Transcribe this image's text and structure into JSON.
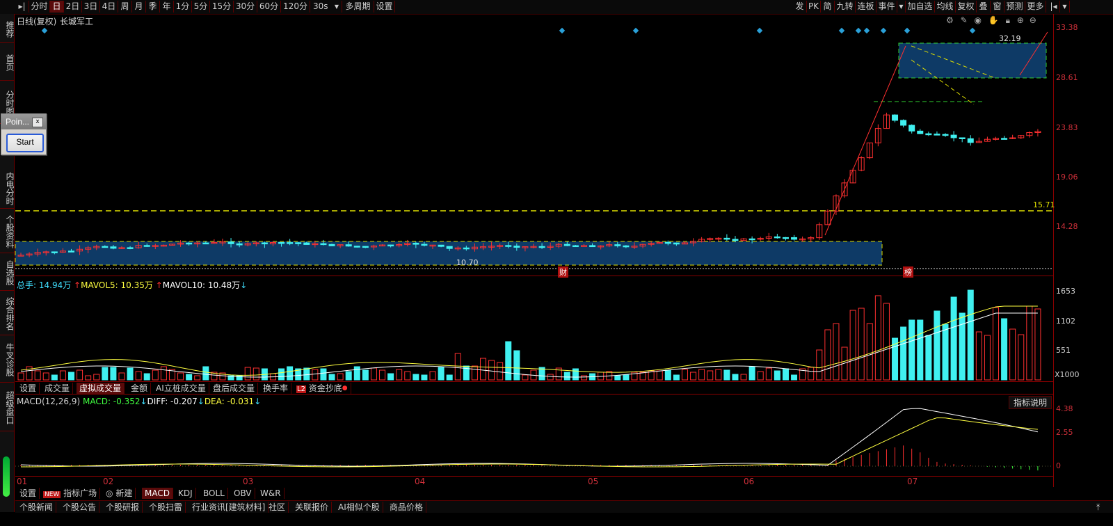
{
  "toolbar": {
    "left_items": [
      "分时",
      "日",
      "2日",
      "3日",
      "4日",
      "周",
      "月",
      "季",
      "年",
      "1分",
      "5分",
      "15分",
      "30分",
      "60分",
      "120分",
      "30s",
      "多周期",
      "设置"
    ],
    "active": "日",
    "right_items": [
      "发",
      "PK",
      "简",
      "九转",
      "连板",
      "事件",
      "加自选",
      "均线",
      "复权",
      "叠",
      "窗",
      "预测",
      "更多"
    ]
  },
  "leftnav": [
    "推荐",
    "首页",
    "分时图",
    "内电分时",
    "个股资料",
    "自选股",
    "综合排名",
    "牛叉诊股",
    "超级盘口"
  ],
  "chart_header": {
    "period": "日线(复权)",
    "name": "长城军工"
  },
  "popup": {
    "title": "Poin...",
    "close": "x",
    "button": "Start"
  },
  "price_panel": {
    "axis_labels": [
      "33.38",
      "28.61",
      "23.83",
      "19.06",
      "14.28"
    ],
    "level_line_label": "15.71",
    "high_label": "32.19",
    "low_label": "10.70",
    "markers": [
      "财",
      "榜"
    ]
  },
  "volume_panel": {
    "legend": [
      {
        "text": "总手: 14.94万",
        "color": "#40e0ff"
      },
      {
        "text": "MAVOL5: 10.35万",
        "color": "#ffff40",
        "prefix_arrow": "↑"
      },
      {
        "text": "MAVOL10: 10.48万",
        "color": "#ffffff",
        "prefix_arrow": "↑",
        "suffix_arrow": "↓"
      }
    ],
    "axis_labels": [
      "1653",
      "1102",
      "551"
    ],
    "unit": "X1000"
  },
  "indicator_tabs": [
    "设置",
    "成交量",
    "虚拟成交量",
    "金额",
    "AI立桩成交量",
    "盘后成交量",
    "换手率",
    "资金抄底"
  ],
  "indicator_tabs_active": "虚拟成交量",
  "l2_badge": "L2",
  "macd_panel": {
    "legend": [
      {
        "text": "MACD(12,26,9)",
        "color": "#d0d0d0"
      },
      {
        "text": "MACD: -0.352",
        "color": "#40ff40",
        "suffix_arrow": "↓"
      },
      {
        "text": "DIFF: -0.207",
        "color": "#ffffff",
        "suffix_arrow": "↓"
      },
      {
        "text": "DEA: -0.031",
        "color": "#ffff40",
        "suffix_arrow": "↓"
      }
    ],
    "axis_labels": [
      "4.38",
      "2.55",
      "0"
    ],
    "help_button": "指标说明"
  },
  "x_axis": [
    "01",
    "02",
    "03",
    "04",
    "05",
    "06",
    "07"
  ],
  "formula_tabs": [
    "设置",
    "指标广场",
    "新建",
    "MACD",
    "KDJ",
    "BOLL",
    "OBV",
    "W&R"
  ],
  "formula_tabs_active": "MACD",
  "new_badge": "NEW",
  "bottom_tabs": [
    "个股新闻",
    "个股公告",
    "个股研报",
    "个股扫雷",
    "行业资讯[建筑材料]",
    "社区",
    "关联报价",
    "AI相似个股",
    "商品价格"
  ],
  "colors": {
    "up": "#ff3030",
    "down": "#40f0f0",
    "box": "#0e3a66",
    "dash": "#e0e000",
    "separator": "#8a0000"
  }
}
